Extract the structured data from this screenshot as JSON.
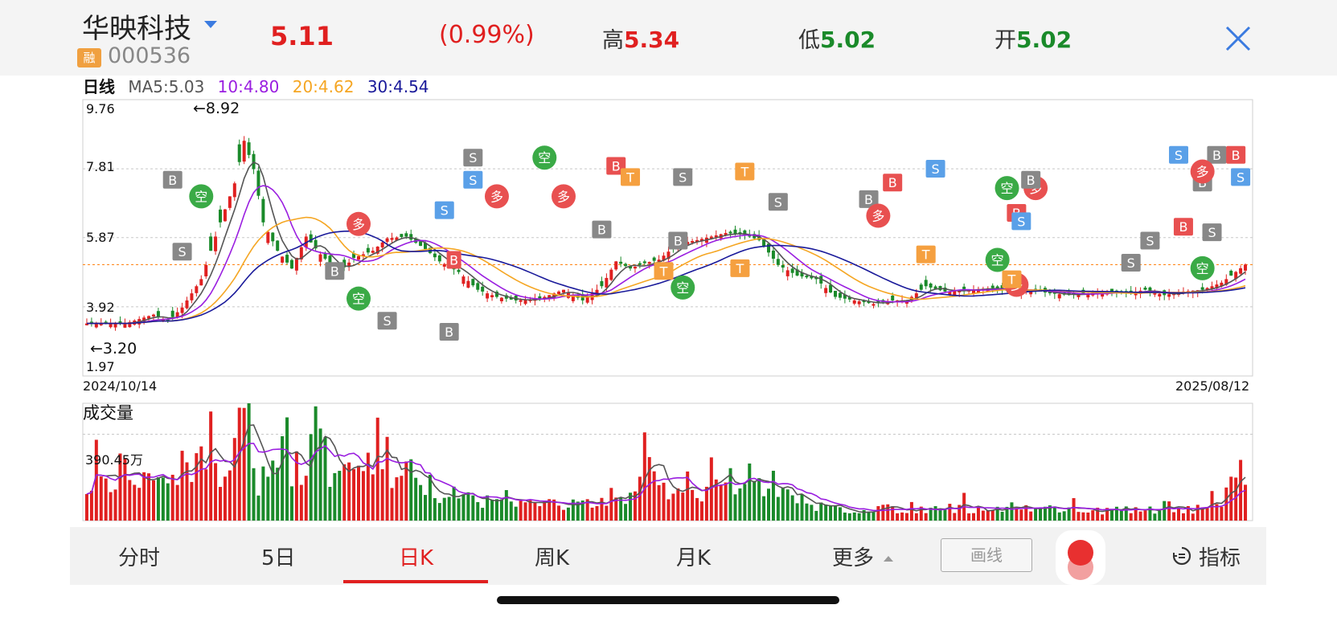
{
  "header": {
    "name": "华映科技",
    "margin_badge": "融",
    "code": "000536",
    "price": "5.11",
    "change_pct": "(0.99%)",
    "high_label": "高",
    "high": "5.34",
    "low_label": "低",
    "low": "5.02",
    "open_label": "开",
    "open": "5.02"
  },
  "ma_legend": {
    "period": "日线",
    "ma5": "MA5:5.03",
    "ma10": "10:4.80",
    "ma20": "20:4.62",
    "ma30": "30:4.54"
  },
  "colors": {
    "up": "#e02020",
    "down": "#1a8a2a",
    "ma5": "#555555",
    "ma10": "#9a1ee0",
    "ma20": "#f5a623",
    "ma30": "#1a1a9a",
    "current_price": "#ff7a00"
  },
  "chart_data": [
    {
      "type": "candlestick",
      "title": "日线",
      "y_axis_ticks": [
        "9.76",
        "7.81",
        "5.87",
        "3.92",
        "1.97"
      ],
      "ylim": [
        1.97,
        9.76
      ],
      "x_start": "2024/10/14",
      "x_end": "2025/08/12",
      "max_marker": "←8.92",
      "min_marker": "←3.20",
      "current_price": 5.11,
      "grid": true,
      "ma_series": [
        {
          "name": "MA5",
          "last": 5.03
        },
        {
          "name": "10",
          "last": 4.8
        },
        {
          "name": "20",
          "last": 4.62
        },
        {
          "name": "30",
          "last": 4.54
        }
      ],
      "close_path": [
        [
          0,
          3.45
        ],
        [
          8,
          3.45
        ],
        [
          14,
          3.7
        ],
        [
          17,
          3.5
        ],
        [
          20,
          3.9
        ],
        [
          24,
          4.7
        ],
        [
          28,
          6.3
        ],
        [
          31,
          7.4
        ],
        [
          33,
          8.6
        ],
        [
          35,
          7.8
        ],
        [
          37,
          6.3
        ],
        [
          40,
          5.5
        ],
        [
          43,
          5.0
        ],
        [
          46,
          5.9
        ],
        [
          49,
          5.4
        ],
        [
          53,
          4.9
        ],
        [
          56,
          5.3
        ],
        [
          60,
          5.5
        ],
        [
          63,
          5.85
        ],
        [
          67,
          5.9
        ],
        [
          71,
          5.55
        ],
        [
          74,
          5.2
        ],
        [
          78,
          4.9
        ],
        [
          82,
          4.4
        ],
        [
          86,
          4.2
        ],
        [
          90,
          4.1
        ],
        [
          95,
          4.15
        ],
        [
          100,
          4.4
        ],
        [
          104,
          4.1
        ],
        [
          108,
          4.5
        ],
        [
          111,
          5.2
        ],
        [
          114,
          5.0
        ],
        [
          117,
          5.15
        ],
        [
          120,
          5.25
        ],
        [
          124,
          5.7
        ],
        [
          128,
          5.8
        ],
        [
          131,
          5.9
        ],
        [
          134,
          6.0
        ],
        [
          138,
          5.95
        ],
        [
          141,
          5.8
        ],
        [
          145,
          5.1
        ],
        [
          149,
          4.8
        ],
        [
          153,
          4.7
        ],
        [
          157,
          4.2
        ],
        [
          161,
          4.1
        ],
        [
          165,
          4.0
        ],
        [
          169,
          4.1
        ],
        [
          172,
          4.1
        ],
        [
          176,
          4.5
        ],
        [
          180,
          4.35
        ],
        [
          185,
          4.4
        ],
        [
          190,
          4.45
        ],
        [
          194,
          4.35
        ],
        [
          198,
          4.4
        ],
        [
          202,
          4.3
        ],
        [
          206,
          4.25
        ],
        [
          210,
          4.3
        ],
        [
          214,
          4.35
        ],
        [
          218,
          4.3
        ],
        [
          222,
          4.4
        ],
        [
          226,
          4.25
        ],
        [
          230,
          4.35
        ],
        [
          234,
          4.4
        ],
        [
          238,
          4.6
        ],
        [
          240,
          4.8
        ],
        [
          243,
          5.11
        ]
      ],
      "labels": [
        {
          "text": "S",
          "color": "#888888"
        },
        {
          "text": "B",
          "color": "#888888"
        },
        {
          "text": "空",
          "color": "#3aaa46"
        },
        {
          "text": "B",
          "color": "#888888"
        },
        {
          "text": "S",
          "color": "#888888"
        },
        {
          "text": "B",
          "color": "#888888"
        },
        {
          "text": "S",
          "color": "#5aa0e8"
        },
        {
          "text": "空",
          "color": "#3aaa46"
        },
        {
          "text": "多",
          "color": "#e85050"
        },
        {
          "text": "S",
          "color": "#888888"
        },
        {
          "text": "S",
          "color": "#5aa0e8"
        },
        {
          "text": "B",
          "color": "#e85050"
        },
        {
          "text": "多",
          "color": "#e85050"
        },
        {
          "text": "空",
          "color": "#3aaa46"
        },
        {
          "text": "多",
          "color": "#e85050"
        },
        {
          "text": "B",
          "color": "#888888"
        },
        {
          "text": "B",
          "color": "#e85050"
        },
        {
          "text": "T",
          "color": "#f5a040"
        },
        {
          "text": "T",
          "color": "#f5a040"
        },
        {
          "text": "B",
          "color": "#888888"
        },
        {
          "text": "S",
          "color": "#888888"
        },
        {
          "text": "空",
          "color": "#3aaa46"
        },
        {
          "text": "T",
          "color": "#f5a040"
        },
        {
          "text": "T",
          "color": "#f5a040"
        },
        {
          "text": "S",
          "color": "#888888"
        },
        {
          "text": "B",
          "color": "#888888"
        },
        {
          "text": "多",
          "color": "#e85050"
        },
        {
          "text": "B",
          "color": "#e85050"
        },
        {
          "text": "S",
          "color": "#5aa0e8"
        },
        {
          "text": "T",
          "color": "#f5a040"
        },
        {
          "text": "空",
          "color": "#3aaa46"
        },
        {
          "text": "空",
          "color": "#3aaa46"
        },
        {
          "text": "B",
          "color": "#e85050"
        },
        {
          "text": "多",
          "color": "#e85050"
        },
        {
          "text": "S",
          "color": "#5aa0e8"
        },
        {
          "text": "T",
          "color": "#f5a040"
        },
        {
          "text": "多",
          "color": "#e85050"
        },
        {
          "text": "B",
          "color": "#888888"
        },
        {
          "text": "S",
          "color": "#888888"
        },
        {
          "text": "S",
          "color": "#888888"
        },
        {
          "text": "B",
          "color": "#e85050"
        },
        {
          "text": "S",
          "color": "#5aa0e8"
        },
        {
          "text": "S",
          "color": "#888888"
        },
        {
          "text": "B",
          "color": "#888888"
        },
        {
          "text": "B",
          "color": "#888888"
        },
        {
          "text": "空",
          "color": "#3aaa46"
        },
        {
          "text": "多",
          "color": "#e85050"
        },
        {
          "text": "B",
          "color": "#e85050"
        },
        {
          "text": "S",
          "color": "#5aa0e8"
        }
      ]
    },
    {
      "type": "bar",
      "title": "成交量",
      "y_tick": "390.45万",
      "ylim_wan": [
        0,
        530
      ],
      "volume_path_wan": [
        [
          0,
          160
        ],
        [
          10,
          170
        ],
        [
          20,
          190
        ],
        [
          24,
          260
        ],
        [
          26,
          550
        ],
        [
          28,
          200
        ],
        [
          30,
          260
        ],
        [
          32,
          470
        ],
        [
          34,
          480
        ],
        [
          36,
          200
        ],
        [
          38,
          200
        ],
        [
          40,
          380
        ],
        [
          42,
          300
        ],
        [
          44,
          250
        ],
        [
          46,
          280
        ],
        [
          48,
          400
        ],
        [
          50,
          300
        ],
        [
          52,
          240
        ],
        [
          56,
          180
        ],
        [
          60,
          290
        ],
        [
          62,
          180
        ],
        [
          64,
          200
        ],
        [
          66,
          240
        ],
        [
          70,
          200
        ],
        [
          74,
          140
        ],
        [
          80,
          110
        ],
        [
          90,
          85
        ],
        [
          100,
          80
        ],
        [
          110,
          80
        ],
        [
          114,
          90
        ],
        [
          116,
          190
        ],
        [
          118,
          240
        ],
        [
          120,
          210
        ],
        [
          122,
          130
        ],
        [
          124,
          150
        ],
        [
          126,
          180
        ],
        [
          128,
          160
        ],
        [
          130,
          130
        ],
        [
          131,
          500
        ],
        [
          132,
          200
        ],
        [
          134,
          240
        ],
        [
          136,
          200
        ],
        [
          140,
          160
        ],
        [
          144,
          130
        ],
        [
          148,
          110
        ],
        [
          152,
          80
        ],
        [
          156,
          60
        ],
        [
          160,
          55
        ],
        [
          170,
          55
        ],
        [
          180,
          60
        ],
        [
          190,
          55
        ],
        [
          195,
          70
        ],
        [
          200,
          60
        ],
        [
          210,
          50
        ],
        [
          220,
          50
        ],
        [
          230,
          50
        ],
        [
          238,
          70
        ],
        [
          240,
          160
        ],
        [
          242,
          180
        ],
        [
          243,
          170
        ]
      ],
      "ma_series": [
        {
          "name": "MA5"
        },
        {
          "name": "MA10"
        }
      ]
    }
  ],
  "volume_title": "成交量",
  "tabs": [
    "分时",
    "5日",
    "日K",
    "周K",
    "月K",
    "更多"
  ],
  "active_tab": "日K",
  "draw_button": "画线",
  "indicator_button": "指标"
}
